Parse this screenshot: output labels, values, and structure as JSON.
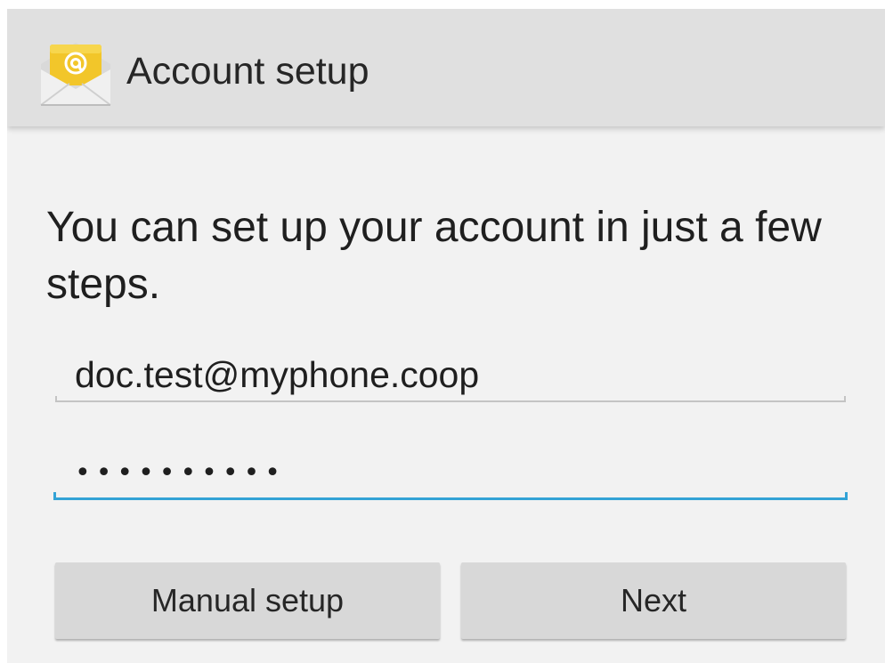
{
  "action_bar": {
    "title": "Account setup",
    "icon": "email-app-icon",
    "icon_color": "#f2c62a"
  },
  "main": {
    "headline": "You can set up your account in just a few steps.",
    "email": {
      "value": "doc.test@myphone.coop"
    },
    "password": {
      "value": "••••••••••"
    },
    "focus_color": "#33a3d6"
  },
  "buttons": {
    "manual_setup": "Manual setup",
    "next": "Next"
  }
}
